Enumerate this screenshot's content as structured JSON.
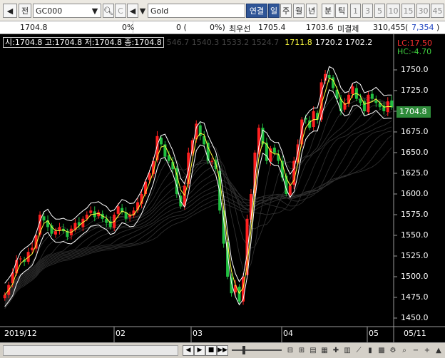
{
  "toolbar": {
    "prev_label": "◀",
    "all_label": "전",
    "symbol_value": "GC000",
    "search_icon": "search-icon",
    "compare_icon": "compare-icon",
    "sound_icon": "speaker-icon",
    "name_value": "Gold",
    "link_label": "연결",
    "periods": [
      "일",
      "주",
      "월",
      "년",
      "분",
      "틱"
    ],
    "minutes": [
      "1",
      "3",
      "5",
      "10",
      "15",
      "30",
      "45"
    ]
  },
  "pricebar": {
    "current": "1704.8",
    "change_pct": "0%",
    "change": "0 (",
    "change_pct2": "0%)",
    "best_label": "최우선",
    "bid": "1705.4",
    "ask": "1703.6",
    "oi_label": "미결제",
    "oi": "310,455",
    "oi_change_open": "(",
    "oi_change": "7,354",
    "oi_change_close": ")"
  },
  "chart": {
    "ohlc_line": "시:1704.8 고:1704.8 저:1704.8 종:1704.8",
    "ma_line_dim": "546.7 1540.3 1533.2 1524.7",
    "ma_line_yellow": "1711.8",
    "ma_line_rest": "1720.2 1702.2",
    "lc_text": "LC:17.50",
    "hc_text": "HC:-4.70",
    "last_price": "1704.8",
    "y_ticks": [
      "1750.0",
      "1725.0",
      "1700.0",
      "1675.0",
      "1650.0",
      "1625.0",
      "1600.0",
      "1575.0",
      "1550.0",
      "1525.0",
      "1500.0",
      "1475.0",
      "1450.0"
    ],
    "x_ticks": [
      "2019/12",
      "02",
      "03",
      "04",
      "05",
      "05/11"
    ],
    "colors": {
      "up": "#ff2020",
      "down": "#20c040",
      "ma": "#ffff40",
      "band": "#ffffff",
      "bg": "#000000"
    }
  },
  "chart_data": {
    "type": "candlestick",
    "title": "",
    "ylim": [
      1450,
      1760
    ],
    "categories": [
      "2019/12",
      "02",
      "03",
      "04",
      "05",
      "05/11"
    ],
    "series": [
      {
        "name": "close",
        "values": [
          1478,
          1490,
          1505,
          1520,
          1522,
          1518,
          1530,
          1535,
          1550,
          1575,
          1568,
          1560,
          1552,
          1555,
          1560,
          1555,
          1548,
          1558,
          1565,
          1562,
          1570,
          1575,
          1580,
          1572,
          1578,
          1570,
          1565,
          1560,
          1575,
          1585,
          1578,
          1570,
          1575,
          1580,
          1590,
          1600,
          1615,
          1625,
          1640,
          1670,
          1660,
          1645,
          1640,
          1630,
          1600,
          1585,
          1610,
          1650,
          1665,
          1685,
          1670,
          1660,
          1640,
          1640,
          1630,
          1580,
          1540,
          1500,
          1480,
          1490,
          1470,
          1500,
          1570,
          1600,
          1650,
          1680,
          1660,
          1640,
          1655,
          1650,
          1640,
          1620,
          1600,
          1610,
          1640,
          1660,
          1690,
          1690,
          1680,
          1700,
          1690,
          1735,
          1745,
          1740,
          1728,
          1715,
          1700,
          1710,
          1720,
          1730,
          1715,
          1710,
          1700,
          1720,
          1715,
          1710,
          1705,
          1700,
          1712,
          1704.8
        ]
      }
    ]
  },
  "bottombar": {
    "buttons": [
      "◀",
      "▶",
      "■",
      "▶▶"
    ],
    "icons": [
      "zoom-out-icon",
      "zoom-in-icon",
      "layout-icon",
      "grid-icon",
      "crosshair-icon",
      "chart-icon",
      "line-icon",
      "candle-icon",
      "bar-icon",
      "settings-icon",
      "search-icon",
      "plus-icon",
      "up-icon"
    ]
  }
}
